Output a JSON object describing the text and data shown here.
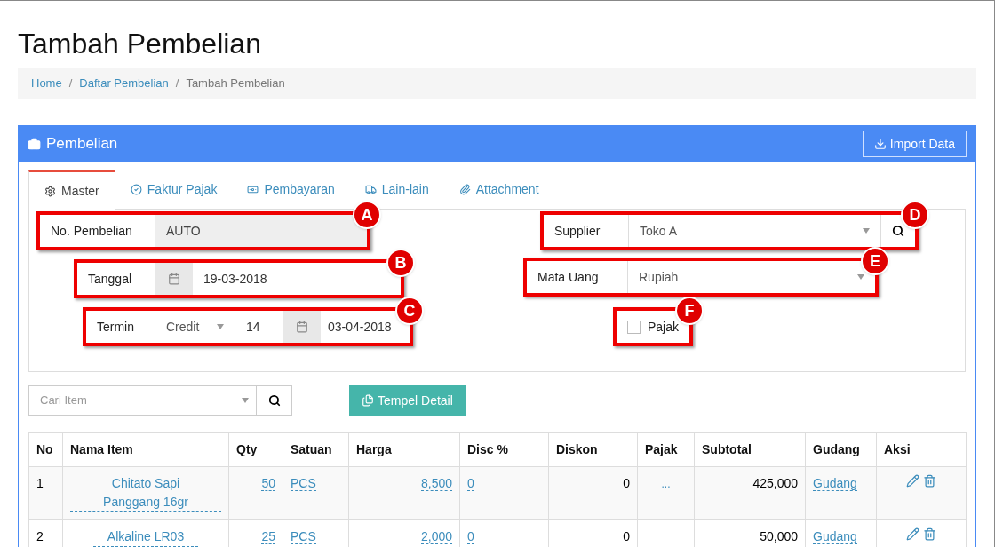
{
  "page_title": "Tambah Pembelian",
  "breadcrumb": [
    {
      "label": "Home",
      "current": false
    },
    {
      "separator": "/",
      "label": "Daftar Pembelian",
      "current": false
    },
    {
      "separator": "/",
      "label": "Tambah Pembelian",
      "current": true
    }
  ],
  "panel": {
    "title": "Pembelian",
    "import_button": "Import Data"
  },
  "tabs": [
    {
      "label": "Master",
      "selected": true
    },
    {
      "label": "Faktur Pajak",
      "selected": false
    },
    {
      "label": "Pembayaran",
      "selected": false
    },
    {
      "label": "Lain-lain",
      "selected": false
    },
    {
      "label": "Attachment",
      "selected": false
    }
  ],
  "form": {
    "no_pembelian": {
      "label": "No. Pembelian",
      "value": "AUTO",
      "callout": "A"
    },
    "tanggal": {
      "label": "Tanggal",
      "value": "19-03-2018",
      "callout": "B"
    },
    "termin": {
      "label": "Termin",
      "type": "Credit",
      "days": "14",
      "due_date": "03-04-2018",
      "callout": "C"
    },
    "supplier": {
      "label": "Supplier",
      "value": "Toko A",
      "callout": "D"
    },
    "mata_uang": {
      "label": "Mata Uang",
      "value": "Rupiah",
      "callout": "E"
    },
    "pajak": {
      "label": "Pajak",
      "checked": false,
      "callout": "F"
    }
  },
  "item_search": {
    "placeholder": "Cari Item"
  },
  "paste_button": "Tempel Detail",
  "table": {
    "columns": [
      "No",
      "Nama Item",
      "Qty",
      "Satuan",
      "Harga",
      "Disc %",
      "Diskon",
      "Pajak",
      "Subtotal",
      "Gudang",
      "Aksi"
    ],
    "rows": [
      {
        "no": "1",
        "item": "Chitato Sapi Panggang 16gr",
        "qty": "50",
        "unit": "PCS",
        "price": "8,500",
        "disc_pct": "0",
        "discount": "0",
        "tax": "...",
        "subtotal": "425,000",
        "warehouse": "Gudang"
      },
      {
        "no": "2",
        "item": "Alkaline LR03",
        "qty": "25",
        "unit": "PCS",
        "price": "2,000",
        "disc_pct": "0",
        "discount": "0",
        "subtotal": "50,000",
        "warehouse": "Gudang"
      }
    ]
  }
}
